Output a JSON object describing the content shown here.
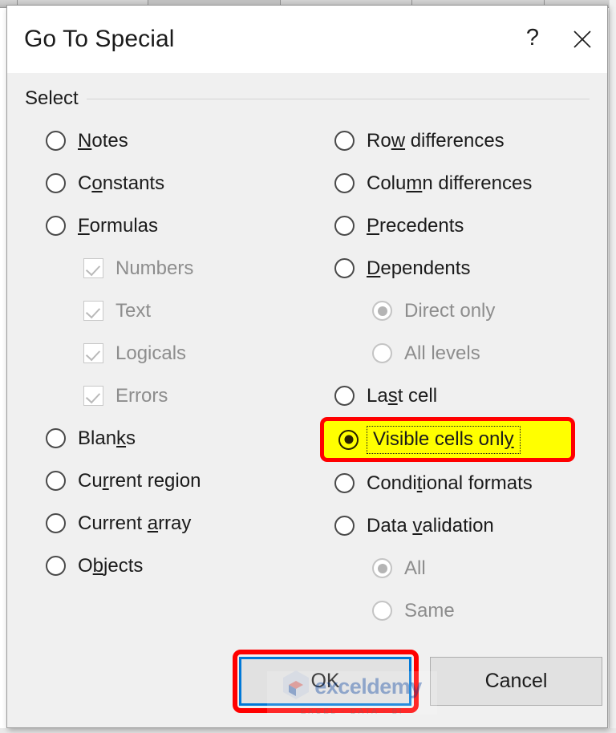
{
  "window": {
    "title": "Go To Special",
    "help_icon": "help-question-icon",
    "close_icon": "close-icon"
  },
  "group": {
    "label": "Select"
  },
  "left_column": [
    {
      "type": "radio",
      "label": "Notes",
      "mnemonic": "N",
      "state": "unchecked",
      "enabled": true,
      "indent": false
    },
    {
      "type": "radio",
      "label": "Constants",
      "mnemonic": "o",
      "state": "unchecked",
      "enabled": true,
      "indent": false
    },
    {
      "type": "radio",
      "label": "Formulas",
      "mnemonic": "F",
      "state": "unchecked",
      "enabled": true,
      "indent": false
    },
    {
      "type": "checkbox",
      "label": "Numbers",
      "mnemonic": "",
      "state": "checked",
      "enabled": false,
      "indent": true
    },
    {
      "type": "checkbox",
      "label": "Text",
      "mnemonic": "",
      "state": "checked",
      "enabled": false,
      "indent": true
    },
    {
      "type": "checkbox",
      "label": "Logicals",
      "mnemonic": "",
      "state": "checked",
      "enabled": false,
      "indent": true
    },
    {
      "type": "checkbox",
      "label": "Errors",
      "mnemonic": "",
      "state": "checked",
      "enabled": false,
      "indent": true
    },
    {
      "type": "radio",
      "label": "Blanks",
      "mnemonic": "k",
      "state": "unchecked",
      "enabled": true,
      "indent": false
    },
    {
      "type": "radio",
      "label": "Current region",
      "mnemonic": "r",
      "state": "unchecked",
      "enabled": true,
      "indent": false
    },
    {
      "type": "radio",
      "label": "Current array",
      "mnemonic": "a",
      "state": "unchecked",
      "enabled": true,
      "indent": false
    },
    {
      "type": "radio",
      "label": "Objects",
      "mnemonic": "b",
      "state": "unchecked",
      "enabled": true,
      "indent": false
    }
  ],
  "right_column": [
    {
      "type": "radio",
      "label": "Row differences",
      "mnemonic": "w",
      "state": "unchecked",
      "enabled": true,
      "indent": false,
      "highlighted": false
    },
    {
      "type": "radio",
      "label": "Column differences",
      "mnemonic": "m",
      "state": "unchecked",
      "enabled": true,
      "indent": false,
      "highlighted": false
    },
    {
      "type": "radio",
      "label": "Precedents",
      "mnemonic": "P",
      "state": "unchecked",
      "enabled": true,
      "indent": false,
      "highlighted": false
    },
    {
      "type": "radio",
      "label": "Dependents",
      "mnemonic": "D",
      "state": "unchecked",
      "enabled": true,
      "indent": false,
      "highlighted": false
    },
    {
      "type": "radio",
      "label": "Direct only",
      "mnemonic": "",
      "state": "checked",
      "enabled": false,
      "indent": true,
      "highlighted": false
    },
    {
      "type": "radio",
      "label": "All levels",
      "mnemonic": "",
      "state": "unchecked",
      "enabled": false,
      "indent": true,
      "highlighted": false
    },
    {
      "type": "radio",
      "label": "Last cell",
      "mnemonic": "s",
      "state": "unchecked",
      "enabled": true,
      "indent": false,
      "highlighted": false
    },
    {
      "type": "radio",
      "label": "Visible cells only",
      "mnemonic": "y",
      "state": "checked",
      "enabled": true,
      "indent": false,
      "highlighted": true
    },
    {
      "type": "radio",
      "label": "Conditional formats",
      "mnemonic": "t",
      "state": "unchecked",
      "enabled": true,
      "indent": false,
      "highlighted": false
    },
    {
      "type": "radio",
      "label": "Data validation",
      "mnemonic": "v",
      "state": "unchecked",
      "enabled": true,
      "indent": false,
      "highlighted": false
    },
    {
      "type": "radio",
      "label": "All",
      "mnemonic": "",
      "state": "checked",
      "enabled": false,
      "indent": true,
      "highlighted": false
    },
    {
      "type": "radio",
      "label": "Same",
      "mnemonic": "",
      "state": "unchecked",
      "enabled": false,
      "indent": true,
      "highlighted": false
    }
  ],
  "footer": {
    "ok_label": "OK",
    "cancel_label": "Cancel"
  },
  "watermark": {
    "brand": "exceldemy",
    "tagline": "EXCEL - DATA - BI"
  },
  "annotation": {
    "highlight_fill": "#ffff00",
    "highlight_border": "#ff0000",
    "default_button_border": "#0078d7"
  }
}
